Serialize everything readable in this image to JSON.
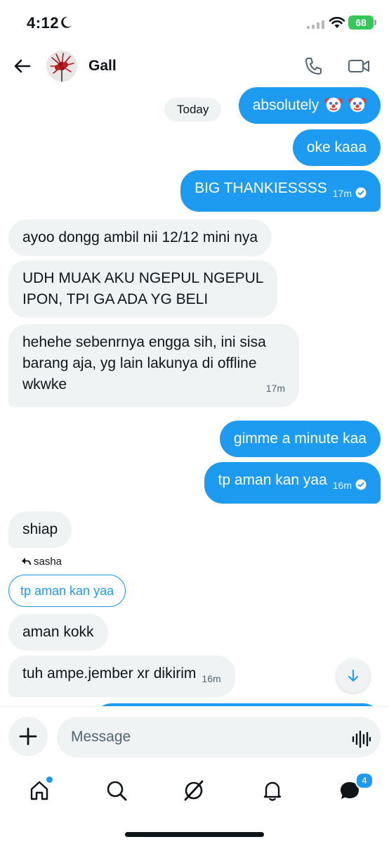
{
  "status_bar": {
    "time": "4:12",
    "battery": "68",
    "icons": [
      "moon-icon",
      "signal-icon",
      "wifi-icon",
      "battery-icon"
    ]
  },
  "header": {
    "contact_name": "Gall",
    "icons": [
      "back-arrow-icon",
      "phone-icon",
      "video-camera-icon"
    ]
  },
  "conversation": {
    "date_separator": "Today",
    "messages": [
      {
        "from": "me",
        "text": "absolutely",
        "emoji": [
          "clown-face",
          "clown-face"
        ]
      },
      {
        "from": "me",
        "text": "oke kaaa"
      },
      {
        "from": "me",
        "text": "BIG THANKIESSSS",
        "time": "17m",
        "status": "seen"
      },
      {
        "from": "them",
        "text": "ayoo dongg ambil nii 12/12 mini nya"
      },
      {
        "from": "them",
        "lines": [
          "UDH MUAK AKU NGEPUL NGEPUL",
          "IPON, TPI GA ADA YG BELI"
        ]
      },
      {
        "from": "them",
        "lines": [
          "hehehe sebenrnya engga sih, ini sisa",
          "barang aja, yg lain lakunya di offline",
          "wkwke"
        ],
        "time": "17m"
      },
      {
        "from": "me",
        "text": "gimme a minute kaa"
      },
      {
        "from": "me",
        "text": "tp aman kan yaa",
        "time": "16m",
        "status": "seen"
      },
      {
        "from": "them",
        "text": "shiap"
      },
      {
        "from": "them",
        "reply_to_label": "sasha",
        "quoted_text": "tp aman kan yaa"
      },
      {
        "from": "them",
        "text": "aman kokk"
      },
      {
        "from": "them",
        "text": "tuh ampe.jember xr  dikirim",
        "time": "16m"
      }
    ]
  },
  "composer": {
    "placeholder": "Message",
    "icons": [
      "plus-icon",
      "voice-waveform-icon"
    ]
  },
  "tab_bar": {
    "tabs": [
      "home",
      "search",
      "grok",
      "notifications",
      "messages"
    ],
    "messages_badge": "4",
    "colors": {
      "accent": "#1d9bf0",
      "incoming_bubble": "#eff3f4",
      "text": "#0f1419"
    }
  }
}
